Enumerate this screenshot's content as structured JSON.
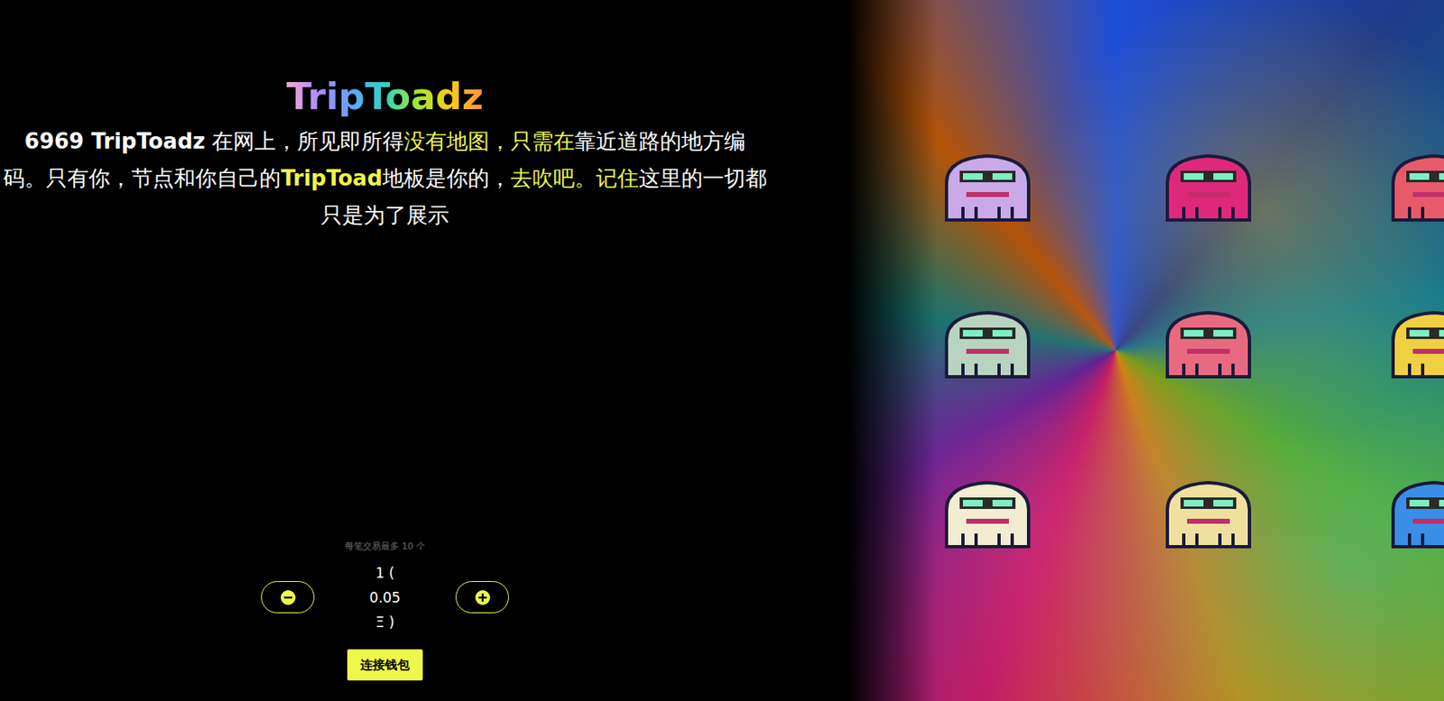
{
  "title": "TripToadz",
  "description": [
    {
      "text": "6969 TripToadz",
      "highlight": false,
      "bold": true
    },
    {
      "text": " 在网上，所见即所得",
      "highlight": false,
      "bold": false
    },
    {
      "text": "没有地图，只需在",
      "highlight": true,
      "bold": false
    },
    {
      "text": "靠近道路的地方编码。只有你，节点和你自己的",
      "highlight": false,
      "bold": false
    },
    {
      "text": "TripToad",
      "highlight": true,
      "bold": true
    },
    {
      "text": "地板是你的，",
      "highlight": false,
      "bold": false
    },
    {
      "text": "去吹吧。记住",
      "highlight": true,
      "bold": false
    },
    {
      "text": "这里的一切都只是为了展示",
      "highlight": false,
      "bold": false
    }
  ],
  "limit_note": "每笔交易最多 10 个",
  "price_lines": [
    "1 (",
    "0.05",
    "Ξ )"
  ],
  "connect_button": "连接钱包"
}
